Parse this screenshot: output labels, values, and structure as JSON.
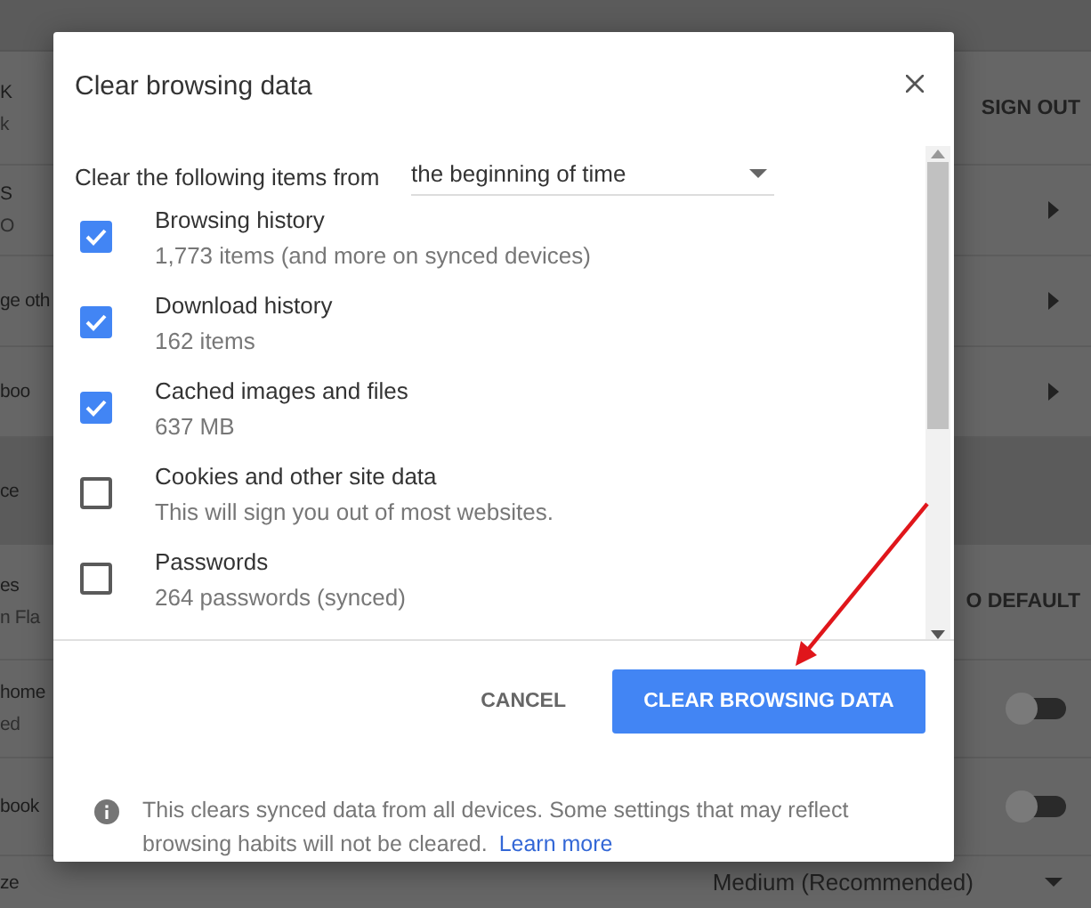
{
  "background_page": {
    "rows": [
      {
        "kind": "account",
        "title": "K",
        "subtitle": "k",
        "action": "SIGN OUT"
      },
      {
        "kind": "link",
        "title": "S",
        "subtitle": "O"
      },
      {
        "kind": "link",
        "title": "ge oth"
      },
      {
        "kind": "link",
        "title": "boo"
      },
      {
        "kind": "section",
        "title": "ce"
      },
      {
        "kind": "reset",
        "title": "es",
        "subtitle": "n Fla",
        "action": "O DEFAULT"
      },
      {
        "kind": "toggle",
        "title": "home",
        "subtitle": "ed",
        "on": false
      },
      {
        "kind": "toggle",
        "title": "book",
        "on": false
      },
      {
        "kind": "dropdown",
        "title": "ze",
        "action": "Medium (Recommended)"
      }
    ]
  },
  "dialog": {
    "title": "Clear browsing data",
    "range_label": "Clear the following items from",
    "range_value": "the beginning of time",
    "items": [
      {
        "label": "Browsing history",
        "detail": "1,773 items (and more on synced devices)",
        "checked": true
      },
      {
        "label": "Download history",
        "detail": "162 items",
        "checked": true
      },
      {
        "label": "Cached images and files",
        "detail": "637 MB",
        "checked": true
      },
      {
        "label": "Cookies and other site data",
        "detail": "This will sign you out of most websites.",
        "checked": false
      },
      {
        "label": "Passwords",
        "detail": "264 passwords (synced)",
        "checked": false
      }
    ],
    "buttons": [
      {
        "label": "CANCEL",
        "kind": "secondary"
      },
      {
        "label": "CLEAR BROWSING DATA",
        "kind": "primary"
      }
    ],
    "note": "This clears synced data from all devices. Some settings that may reflect browsing habits will not be cleared.",
    "note_link": "Learn more"
  }
}
